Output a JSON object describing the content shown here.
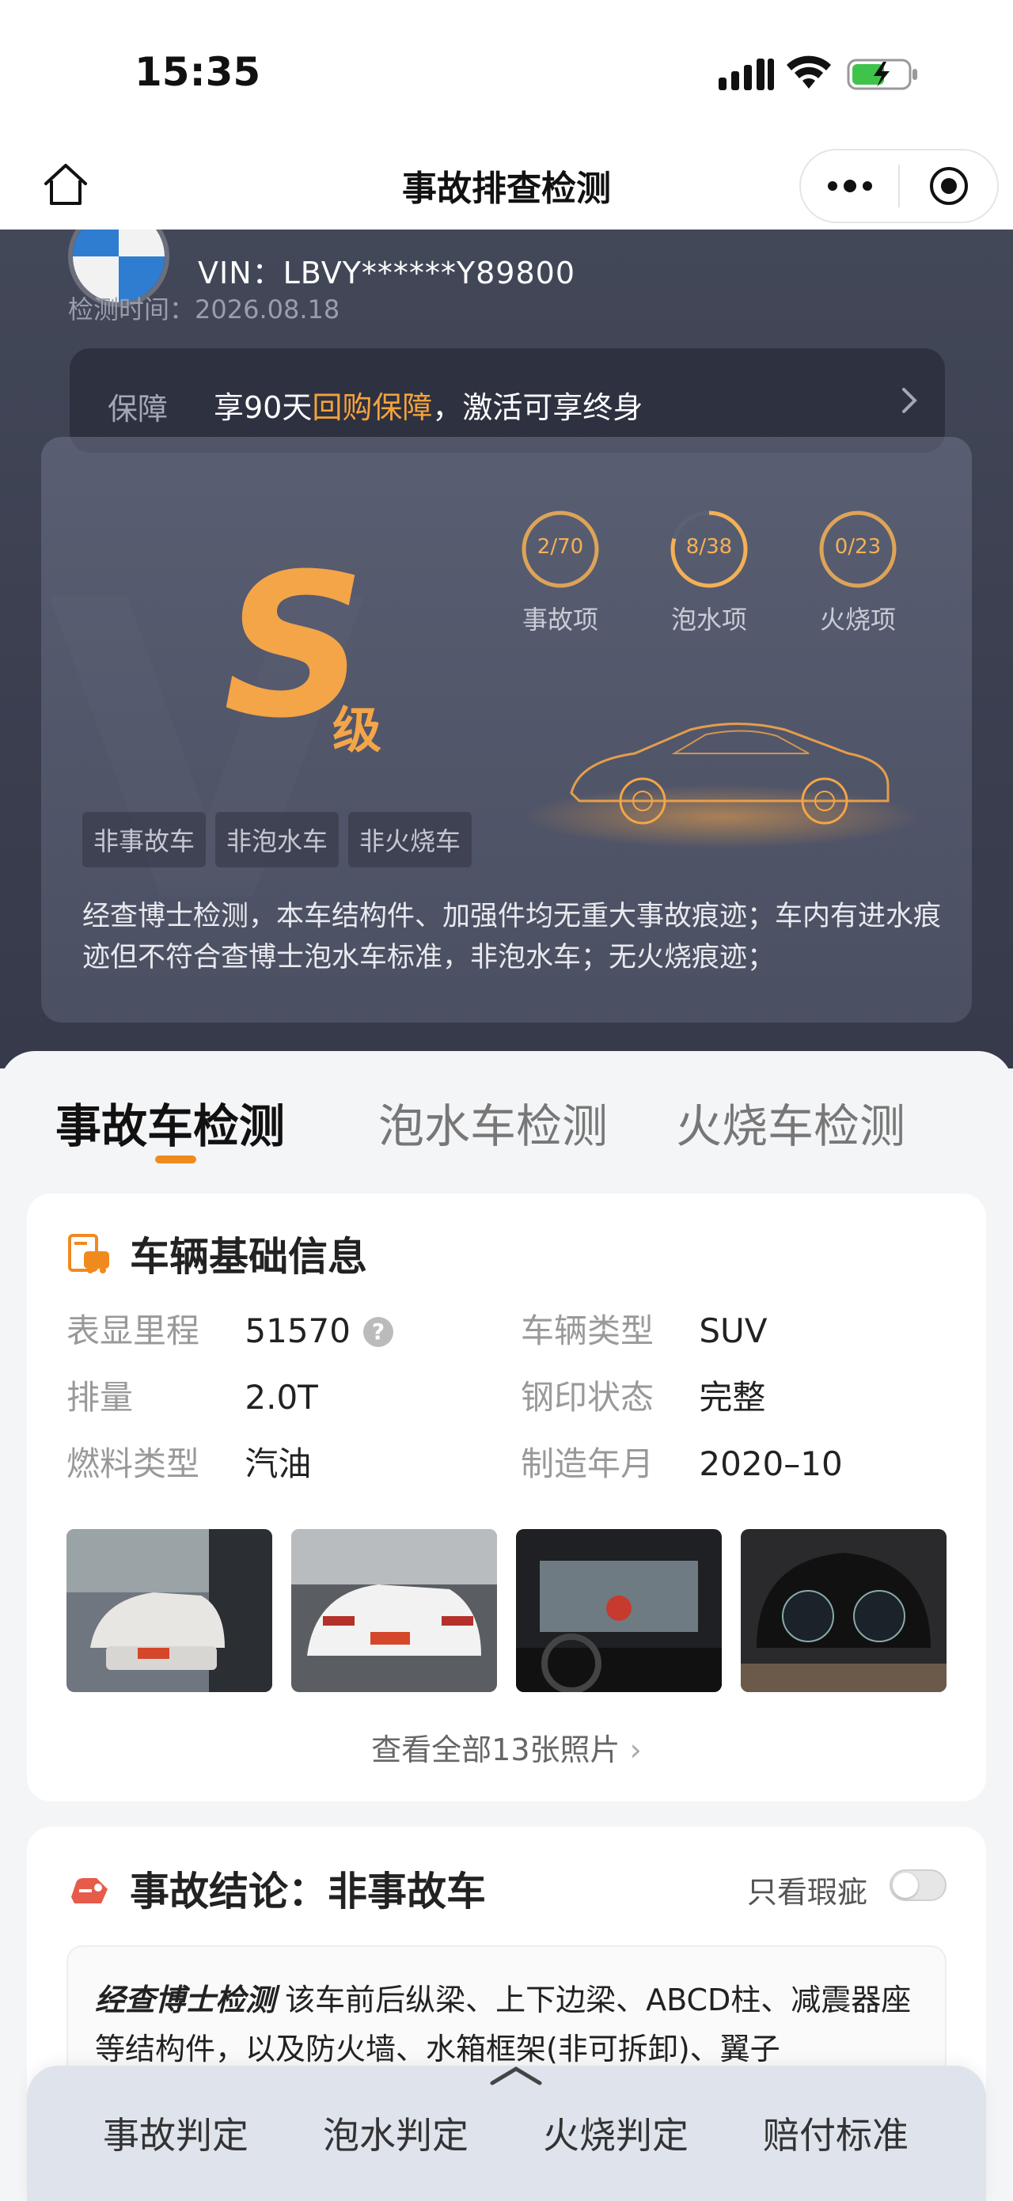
{
  "status_bar": {
    "time": "15:35"
  },
  "nav": {
    "title": "事故排查检测"
  },
  "vehicle": {
    "vin": "VIN：LBVY******Y89800",
    "check_time": "检测时间：2026.08.18"
  },
  "guarantee": {
    "label": "保障",
    "text_prefix": "享90天",
    "highlight": "回购保障",
    "text_suffix": "，激活可享终身"
  },
  "score": {
    "grade": "S",
    "grade_suffix": "级",
    "rings": [
      {
        "value": "2/70",
        "label": "事故项",
        "fraction": 0.0286
      },
      {
        "value": "8/38",
        "label": "泡水项",
        "fraction": 0.21
      },
      {
        "value": "0/23",
        "label": "火烧项",
        "fraction": 0.0
      }
    ],
    "tags": [
      "非事故车",
      "非泡水车",
      "非火烧车"
    ],
    "summary": "经查博士检测，本车结构件、加强件均无重大事故痕迹；车内有进水痕迹但不符合查博士泡水车标准，非泡水车；无火烧痕迹；"
  },
  "tabs": [
    "事故车检测",
    "泡水车检测",
    "火烧车检测"
  ],
  "basic_info": {
    "title": "车辆基础信息",
    "rows": [
      {
        "k1": "表显里程",
        "v1": "51570",
        "k2": "车辆类型",
        "v2": "SUV"
      },
      {
        "k1": "排量",
        "v1": "2.0T",
        "k2": "钢印状态",
        "v2": "完整"
      },
      {
        "k1": "燃料类型",
        "v1": "汽油",
        "k2": "制造年月",
        "v2": "2020–10"
      }
    ],
    "help_glyph": "?",
    "view_all": "查看全部13张照片"
  },
  "conclusion": {
    "title": "事故结论：非事故车",
    "toggle_label": "只看瑕疵",
    "brand": "经查博士检测",
    "text": " 该车前后纵梁、上下边梁、ABCD柱、减震器座等结构件，以及防火墙、水箱框架(非可拆卸)、翼子"
  },
  "bottom_bar": [
    "事故判定",
    "泡水判定",
    "火烧判定",
    "赔付标准"
  ],
  "colors": {
    "accent": "#f08a1f",
    "grade": "#f4a548",
    "hero_bg": "#3e4254"
  }
}
